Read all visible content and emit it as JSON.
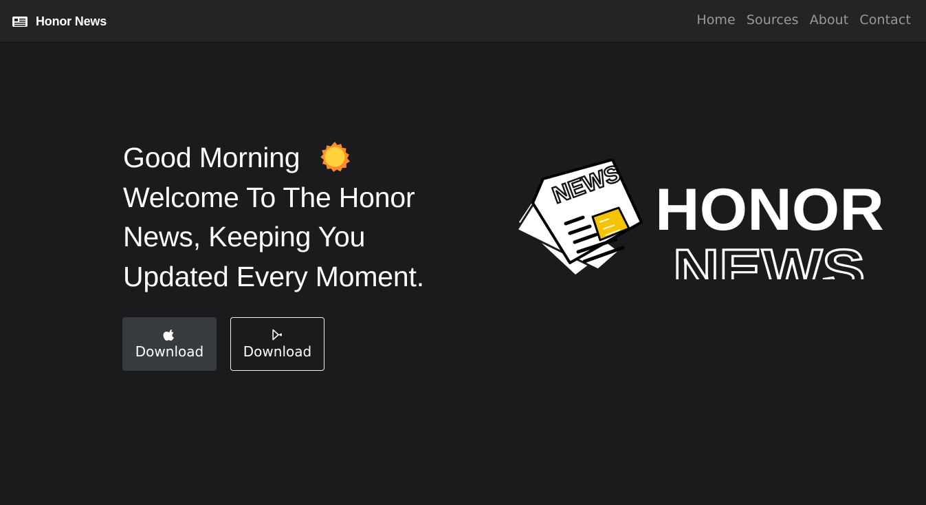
{
  "navbar": {
    "brand_label": "Honor News",
    "brand_icon": "newspaper-icon",
    "links": [
      {
        "label": "Home"
      },
      {
        "label": "Sources"
      },
      {
        "label": "About"
      },
      {
        "label": "Contact"
      }
    ]
  },
  "hero": {
    "greeting": "Good Morning",
    "greeting_icon": "sun-icon",
    "line1": "Welcome To The Honor",
    "line2": "News, Keeping You",
    "line3": "Updated Every Moment."
  },
  "downloads": [
    {
      "label": "Download",
      "icon": "apple-icon"
    },
    {
      "label": "Download",
      "icon": "play-store-icon"
    }
  ],
  "logo": {
    "newspaper_text": "NEWS",
    "wordmark_top": "HONOR",
    "wordmark_bottom": "NEWS"
  },
  "colors": {
    "page_bg": "#1b1b1d",
    "navbar_bg": "#242424",
    "nav_link": "#9a9a9a",
    "button_dark": "#373a3e",
    "sun_orange": "#ff8b2d",
    "sun_yellow": "#ffd23a",
    "news_yellow": "#f5c400"
  }
}
